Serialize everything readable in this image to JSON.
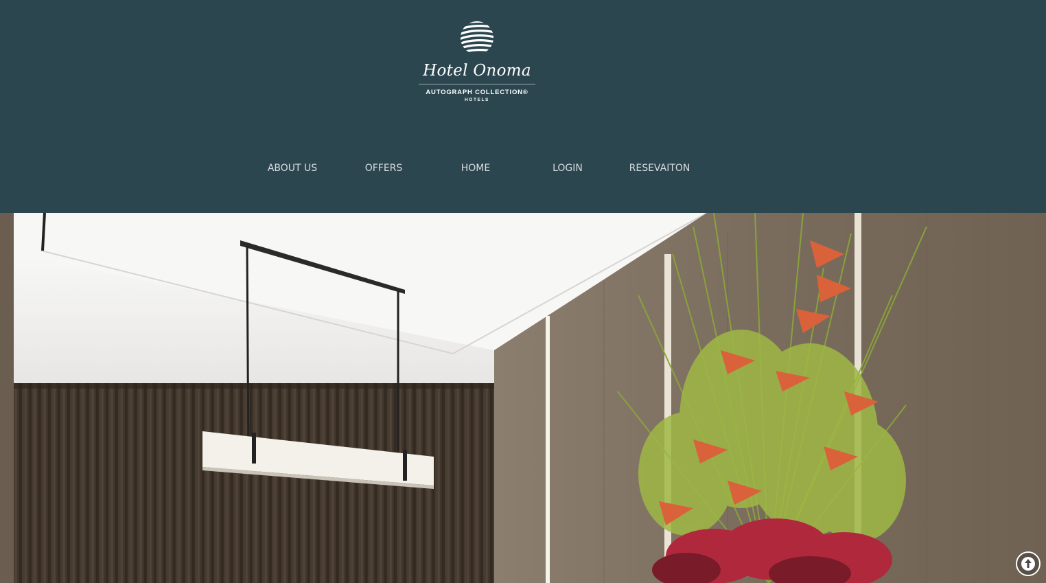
{
  "header": {
    "logo": {
      "name": "Hotel Onoma",
      "collection": "AUTOGRAPH COLLECTION®",
      "collection_sub": "HOTELS"
    },
    "nav": [
      {
        "label": "ABOUT US"
      },
      {
        "label": "OFFERS"
      },
      {
        "label": "HOME"
      },
      {
        "label": "LOGIN"
      },
      {
        "label": "RESEVAITON"
      }
    ]
  },
  "hero": {
    "image": "lobby interior with pendant light, curtains and flower arrangement"
  },
  "scroll_top": {
    "icon": "arrow-up-circle-icon"
  },
  "colors": {
    "header_bg": "#2c4650",
    "nav_text": "#d7dde0"
  }
}
